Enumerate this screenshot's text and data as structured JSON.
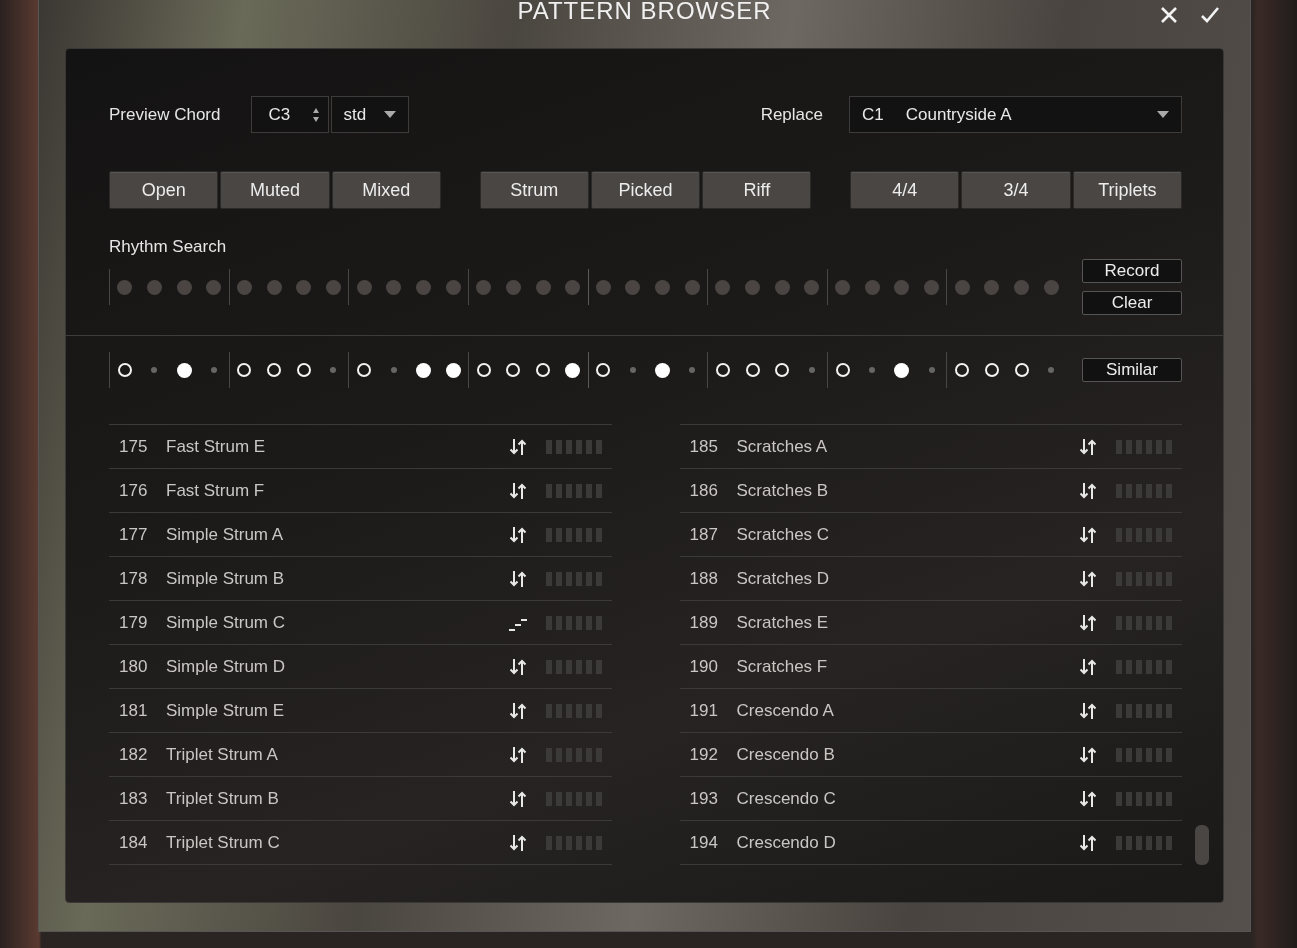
{
  "window": {
    "title": "PATTERN BROWSER"
  },
  "preview_chord": {
    "label": "Preview Chord",
    "note": "C3",
    "voicing": "std"
  },
  "replace": {
    "label": "Replace",
    "slot": "C1",
    "pattern": "Countryside A"
  },
  "filter_groups": [
    [
      "Open",
      "Muted",
      "Mixed"
    ],
    [
      "Strum",
      "Picked",
      "Riff"
    ],
    [
      "4/4",
      "3/4",
      "Triplets"
    ]
  ],
  "rhythm_search": {
    "label": "Rhythm Search",
    "buttons": [
      "Record",
      "Clear"
    ],
    "steps": [
      {
        "on": false
      },
      {
        "on": false
      },
      {
        "on": false
      },
      {
        "on": false
      },
      {
        "on": false
      },
      {
        "on": false
      },
      {
        "on": false
      },
      {
        "on": false
      },
      {
        "on": false
      },
      {
        "on": false
      },
      {
        "on": false
      },
      {
        "on": false
      },
      {
        "on": false
      },
      {
        "on": false
      },
      {
        "on": false
      },
      {
        "on": false
      },
      {
        "on": false
      },
      {
        "on": false
      },
      {
        "on": false
      },
      {
        "on": false
      },
      {
        "on": false
      },
      {
        "on": false
      },
      {
        "on": false
      },
      {
        "on": false
      },
      {
        "on": false
      },
      {
        "on": false
      },
      {
        "on": false
      },
      {
        "on": false
      },
      {
        "on": false
      },
      {
        "on": false
      },
      {
        "on": false
      },
      {
        "on": false
      }
    ]
  },
  "similar": {
    "button": "Similar",
    "steps": [
      {
        "kind": "ring"
      },
      {
        "kind": "rest"
      },
      {
        "kind": "hit"
      },
      {
        "kind": "rest"
      },
      {
        "kind": "ring"
      },
      {
        "kind": "ring"
      },
      {
        "kind": "ring"
      },
      {
        "kind": "rest"
      },
      {
        "kind": "ring"
      },
      {
        "kind": "rest"
      },
      {
        "kind": "hit"
      },
      {
        "kind": "hit"
      },
      {
        "kind": "ring"
      },
      {
        "kind": "ring"
      },
      {
        "kind": "ring"
      },
      {
        "kind": "hit"
      },
      {
        "kind": "ring"
      },
      {
        "kind": "rest"
      },
      {
        "kind": "hit"
      },
      {
        "kind": "rest"
      },
      {
        "kind": "ring"
      },
      {
        "kind": "ring"
      },
      {
        "kind": "ring"
      },
      {
        "kind": "rest"
      },
      {
        "kind": "ring"
      },
      {
        "kind": "rest"
      },
      {
        "kind": "hit"
      },
      {
        "kind": "rest"
      },
      {
        "kind": "ring"
      },
      {
        "kind": "ring"
      },
      {
        "kind": "ring"
      },
      {
        "kind": "rest"
      }
    ]
  },
  "pattern_columns": [
    [
      {
        "number": "175",
        "name": "Fast Strum E",
        "kind": "strum"
      },
      {
        "number": "176",
        "name": "Fast Strum F",
        "kind": "strum"
      },
      {
        "number": "177",
        "name": "Simple Strum A",
        "kind": "strum"
      },
      {
        "number": "178",
        "name": "Simple Strum B",
        "kind": "strum"
      },
      {
        "number": "179",
        "name": "Simple Strum C",
        "kind": "dashes"
      },
      {
        "number": "180",
        "name": "Simple Strum D",
        "kind": "strum"
      },
      {
        "number": "181",
        "name": "Simple Strum E",
        "kind": "strum"
      },
      {
        "number": "182",
        "name": "Triplet Strum A",
        "kind": "strum"
      },
      {
        "number": "183",
        "name": "Triplet Strum B",
        "kind": "strum"
      },
      {
        "number": "184",
        "name": "Triplet Strum C",
        "kind": "strum"
      }
    ],
    [
      {
        "number": "185",
        "name": "Scratches A",
        "kind": "strum"
      },
      {
        "number": "186",
        "name": "Scratches B",
        "kind": "strum"
      },
      {
        "number": "187",
        "name": "Scratches C",
        "kind": "strum"
      },
      {
        "number": "188",
        "name": "Scratches D",
        "kind": "strum"
      },
      {
        "number": "189",
        "name": "Scratches E",
        "kind": "strum"
      },
      {
        "number": "190",
        "name": "Scratches F",
        "kind": "strum"
      },
      {
        "number": "191",
        "name": "Crescendo A",
        "kind": "strum"
      },
      {
        "number": "192",
        "name": "Crescendo B",
        "kind": "strum"
      },
      {
        "number": "193",
        "name": "Crescendo C",
        "kind": "strum"
      },
      {
        "number": "194",
        "name": "Crescendo D",
        "kind": "strum"
      }
    ]
  ]
}
